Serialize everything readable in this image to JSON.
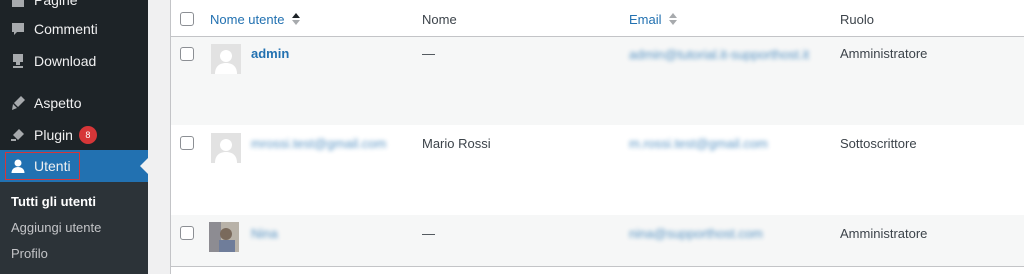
{
  "sidebar": {
    "items": [
      {
        "label": "Pagine",
        "icon": "page-icon"
      },
      {
        "label": "Commenti",
        "icon": "comment-icon"
      },
      {
        "label": "Download",
        "icon": "download-icon"
      },
      {
        "label": "Aspetto",
        "icon": "brush-icon"
      },
      {
        "label": "Plugin",
        "icon": "plugin-icon",
        "badge": "8"
      },
      {
        "label": "Utenti",
        "icon": "user-icon"
      }
    ],
    "submenu": [
      "Tutti gli utenti",
      "Aggiungi utente",
      "Profilo"
    ]
  },
  "table": {
    "columns": {
      "username": "Nome utente",
      "name": "Nome",
      "email": "Email",
      "role": "Ruolo"
    },
    "rows": [
      {
        "username": "admin",
        "name": "—",
        "email": "admin@tutorial.it-supporthost.it",
        "role": "Amministratore"
      },
      {
        "username": "mrossi.test@gmail.com",
        "name": "Mario Rossi",
        "email": "m.rossi.test@gmail.com",
        "role": "Sottoscrittore"
      },
      {
        "username": "Nina",
        "name": "—",
        "email": "nina@supporthost.com",
        "role": "Amministratore"
      }
    ]
  },
  "colors": {
    "sidebar": "#1d2327",
    "accent": "#2271b1",
    "badge": "#d63638"
  }
}
